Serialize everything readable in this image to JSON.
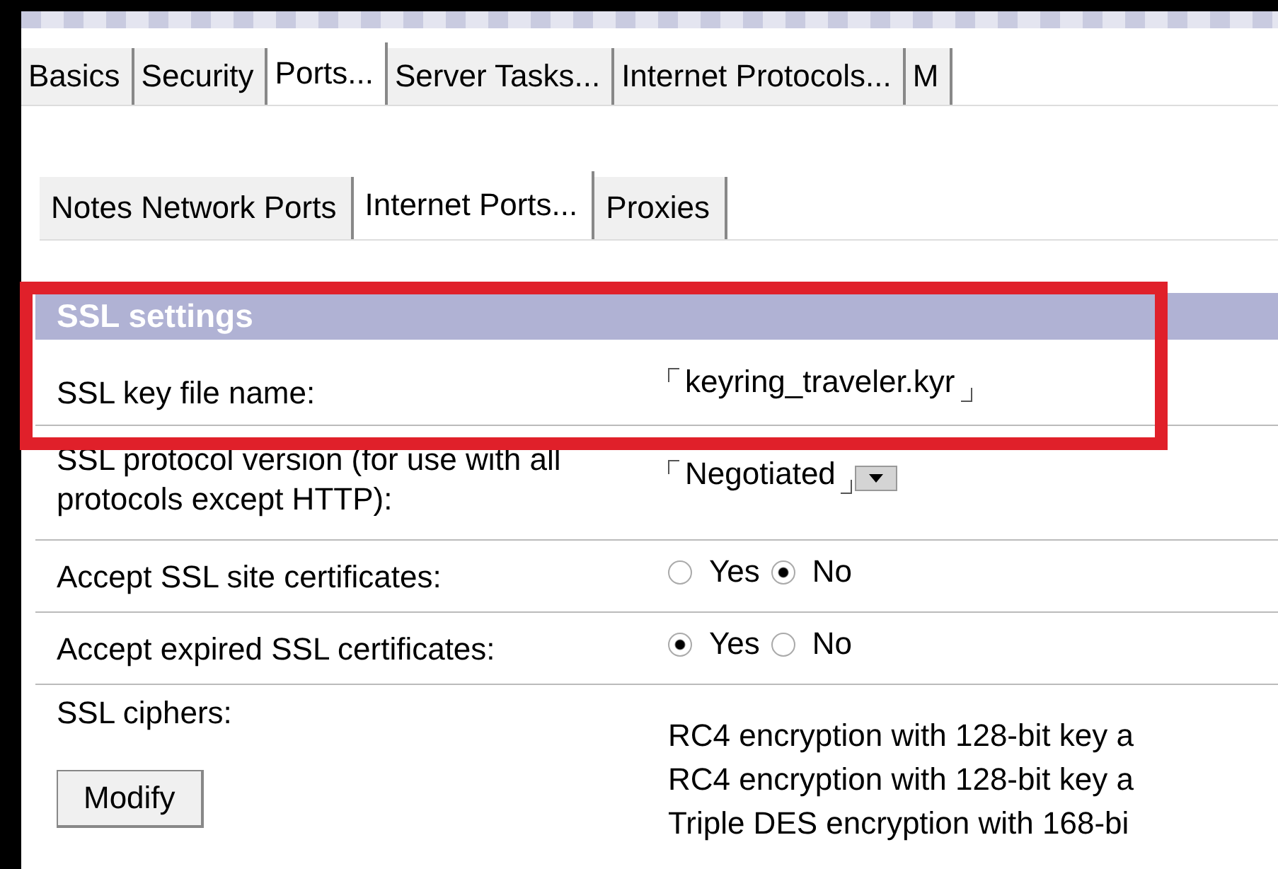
{
  "tabs": [
    {
      "label": "Basics",
      "selected": false
    },
    {
      "label": "Security",
      "selected": false
    },
    {
      "label": "Ports...",
      "selected": true
    },
    {
      "label": "Server Tasks...",
      "selected": false
    },
    {
      "label": "Internet Protocols...",
      "selected": false
    },
    {
      "label": "M",
      "selected": false
    }
  ],
  "subtabs": [
    {
      "label": "Notes Network Ports",
      "selected": false
    },
    {
      "label": "Internet Ports...",
      "selected": true
    },
    {
      "label": "Proxies",
      "selected": false
    }
  ],
  "section": {
    "title": "SSL settings",
    "highlighted": true
  },
  "rows": [
    {
      "kind": "field",
      "label": "SSL key file name:",
      "value": "keyring_traveler.kyr"
    },
    {
      "kind": "dropdown",
      "label": "SSL protocol version (for use with all protocols except HTTP):",
      "value": "Negotiated"
    },
    {
      "kind": "radio",
      "label": "Accept SSL site certificates:",
      "options": [
        {
          "label": "Yes",
          "selected": false
        },
        {
          "label": "No",
          "selected": true
        }
      ]
    },
    {
      "kind": "radio",
      "label": "Accept expired SSL certificates:",
      "options": [
        {
          "label": "Yes",
          "selected": true
        },
        {
          "label": "No",
          "selected": false
        }
      ]
    },
    {
      "kind": "list",
      "label": "SSL ciphers:",
      "button": "Modify",
      "items": [
        "RC4 encryption with 128-bit key a",
        "RC4 encryption with 128-bit key a",
        "Triple DES encryption with 168-bi"
      ]
    }
  ]
}
